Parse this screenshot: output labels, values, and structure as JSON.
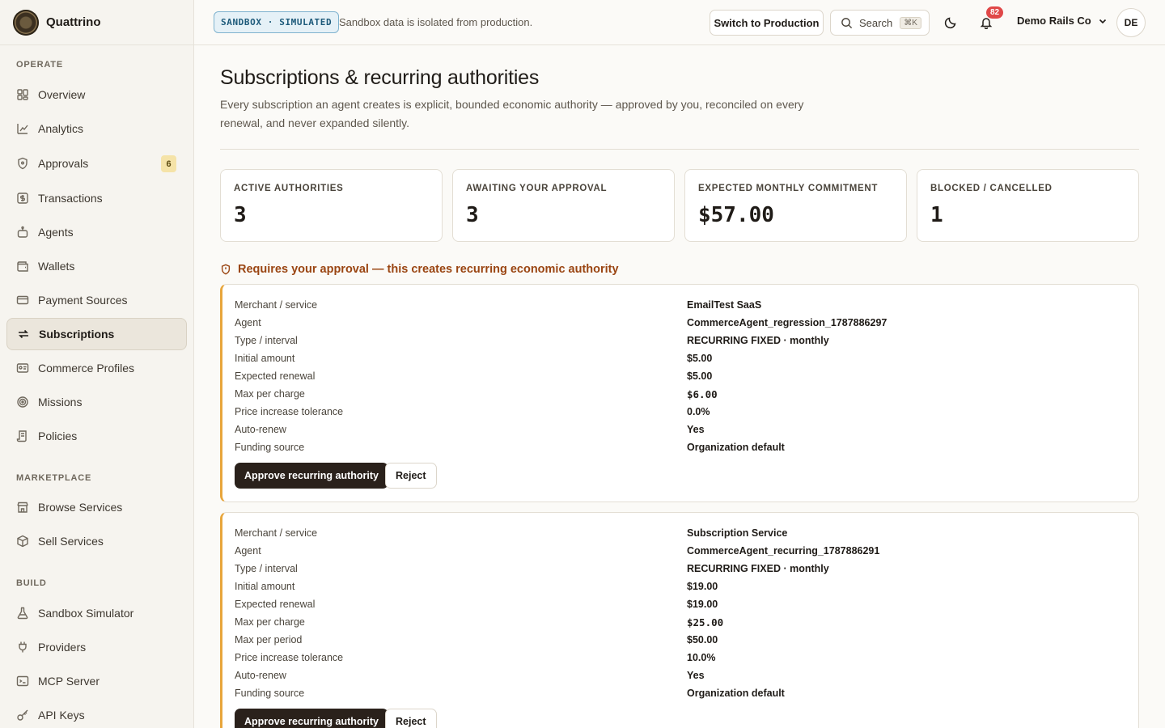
{
  "brand": {
    "name": "Quattrino"
  },
  "sidebar": {
    "sections": {
      "operate": "OPERATE",
      "marketplace": "MARKETPLACE",
      "build": "BUILD"
    },
    "items": [
      {
        "label": "Overview",
        "icon": "grid-icon"
      },
      {
        "label": "Analytics",
        "icon": "chart-icon"
      },
      {
        "label": "Approvals",
        "icon": "shield-icon",
        "badge": "6"
      },
      {
        "label": "Transactions",
        "icon": "dollar-icon"
      },
      {
        "label": "Agents",
        "icon": "robot-icon"
      },
      {
        "label": "Wallets",
        "icon": "wallet-icon"
      },
      {
        "label": "Payment Sources",
        "icon": "card-icon"
      },
      {
        "label": "Subscriptions",
        "icon": "repeat-icon",
        "active": true
      },
      {
        "label": "Commerce Profiles",
        "icon": "id-card-icon"
      },
      {
        "label": "Missions",
        "icon": "target-icon"
      },
      {
        "label": "Policies",
        "icon": "scroll-icon"
      },
      {
        "label": "Browse Services",
        "icon": "store-icon"
      },
      {
        "label": "Sell Services",
        "icon": "package-icon"
      },
      {
        "label": "Sandbox Simulator",
        "icon": "flask-icon"
      },
      {
        "label": "Providers",
        "icon": "plug-icon"
      },
      {
        "label": "MCP Server",
        "icon": "terminal-icon"
      },
      {
        "label": "API Keys",
        "icon": "key-icon"
      }
    ]
  },
  "header": {
    "sandbox_pill": "SANDBOX · SIMULATED",
    "sandbox_note": "Sandbox data is isolated from production.",
    "switch_label": "Switch to Production",
    "search_label": "Search",
    "search_kbd": "⌘K",
    "notif_count": "82",
    "org_name": "Demo Rails Co",
    "avatar_initials": "DE"
  },
  "page": {
    "title": "Subscriptions & recurring authorities",
    "description": "Every subscription an agent creates is explicit, bounded economic authority — approved by you, reconciled on every renewal, and never expanded silently."
  },
  "stats": [
    {
      "label": "ACTIVE AUTHORITIES",
      "value": "3"
    },
    {
      "label": "AWAITING YOUR APPROVAL",
      "value": "3"
    },
    {
      "label": "EXPECTED MONTHLY COMMITMENT",
      "value": "$57.00"
    },
    {
      "label": "BLOCKED / CANCELLED",
      "value": "1"
    }
  ],
  "approval_warning": "Requires your approval — this creates recurring economic authority",
  "cards": [
    {
      "rows": [
        {
          "k": "Merchant / service",
          "v": "EmailTest SaaS"
        },
        {
          "k": "Agent",
          "v": "CommerceAgent_regression_1787886297"
        },
        {
          "k": "Type / interval",
          "v": "RECURRING FIXED · monthly"
        },
        {
          "k": "Initial amount",
          "v": "$5.00"
        },
        {
          "k": "Expected renewal",
          "v": "$5.00"
        },
        {
          "k": "Max per charge",
          "v": "$6.00",
          "mono": true
        },
        {
          "k": "Price increase tolerance",
          "v": "0.0%"
        },
        {
          "k": "Auto-renew",
          "v": "Yes"
        },
        {
          "k": "Funding source",
          "v": "Organization default"
        }
      ],
      "approve_label": "Approve recurring authority",
      "reject_label": "Reject"
    },
    {
      "rows": [
        {
          "k": "Merchant / service",
          "v": "Subscription Service"
        },
        {
          "k": "Agent",
          "v": "CommerceAgent_recurring_1787886291"
        },
        {
          "k": "Type / interval",
          "v": "RECURRING FIXED · monthly"
        },
        {
          "k": "Initial amount",
          "v": "$19.00"
        },
        {
          "k": "Expected renewal",
          "v": "$19.00"
        },
        {
          "k": "Max per charge",
          "v": "$25.00",
          "mono": true
        },
        {
          "k": "Max per period",
          "v": "$50.00"
        },
        {
          "k": "Price increase tolerance",
          "v": "10.0%"
        },
        {
          "k": "Auto-renew",
          "v": "Yes"
        },
        {
          "k": "Funding source",
          "v": "Organization default"
        }
      ],
      "approve_label": "Approve recurring authority",
      "reject_label": "Reject"
    }
  ]
}
